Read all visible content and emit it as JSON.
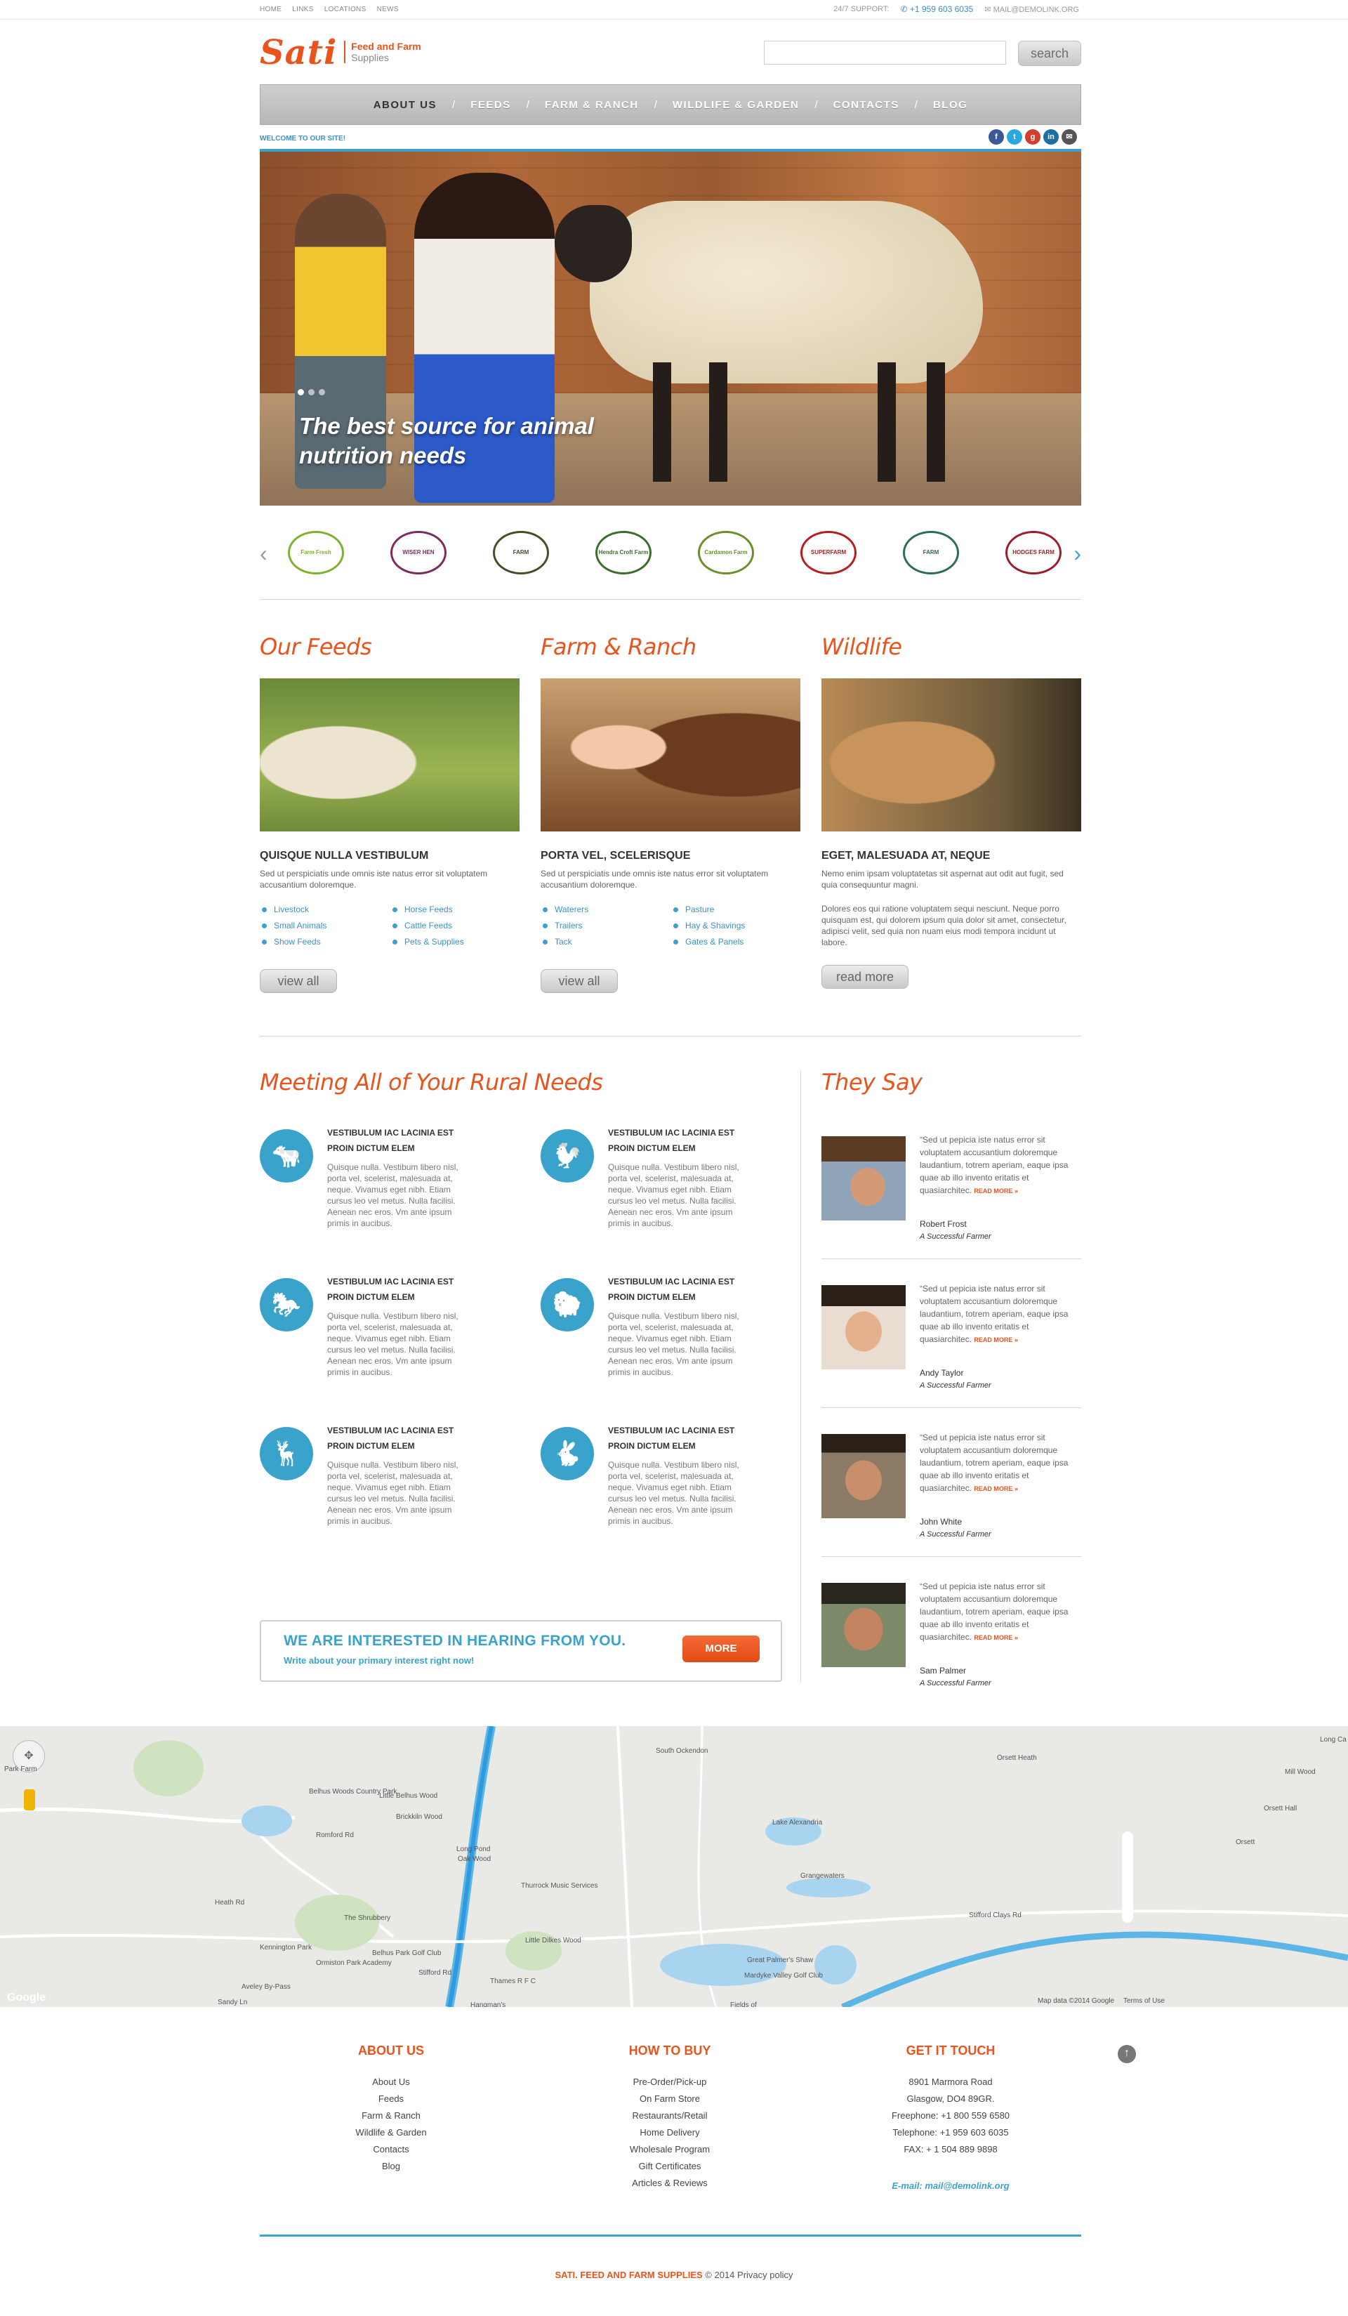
{
  "topbar": {
    "links": [
      "HOME",
      "LINKS",
      "LOCATIONS",
      "NEWS"
    ],
    "support_label": "24/7 SUPPORT:",
    "phone": "+1 959 603 6035",
    "email": "MAIL@DEMOLINK.ORG"
  },
  "logo": {
    "word": "Sati",
    "line1": "Feed and Farm",
    "line2": "Supplies"
  },
  "search": {
    "placeholder": "",
    "button": "search"
  },
  "nav": {
    "items": [
      "ABOUT US",
      "FEEDS",
      "FARM & RANCH",
      "WILDLIFE & GARDEN",
      "CONTACTS",
      "BLOG"
    ],
    "separator": "/"
  },
  "welcome": "WELCOME TO OUR SITE!",
  "social": [
    {
      "icon": "facebook-icon",
      "glyph": "f",
      "color": "#3b5998"
    },
    {
      "icon": "twitter-icon",
      "glyph": "t",
      "color": "#2aa9e0"
    },
    {
      "icon": "google-plus-icon",
      "glyph": "g",
      "color": "#d23f30"
    },
    {
      "icon": "linkedin-icon",
      "glyph": "in",
      "color": "#1b6fa3"
    },
    {
      "icon": "mail-icon",
      "glyph": "✉",
      "color": "#555555"
    }
  ],
  "hero": {
    "caption_line1": "The best source for animal",
    "caption_line2": "nutrition needs"
  },
  "brands": [
    {
      "name": "Farm Fresh",
      "color": "#7fb12c"
    },
    {
      "name": "WISER HEN",
      "color": "#7d2b5c"
    },
    {
      "name": "FARM",
      "color": "#4b4b2a"
    },
    {
      "name": "Hendra Croft Farm",
      "color": "#3e6d2a"
    },
    {
      "name": "Cardamon Farm",
      "color": "#6a8f2c"
    },
    {
      "name": "SUPERFARM",
      "color": "#b81d1d"
    },
    {
      "name": "FARM",
      "color": "#2b6d5b"
    },
    {
      "name": "HODGES FARM",
      "color": "#9a1f2a"
    }
  ],
  "columns": [
    {
      "heading": "Our Feeds",
      "title": "QUISQUE NULLA VESTIBULUM",
      "text": "Sed ut perspiciatis unde omnis iste natus error sit voluptatem accusantium doloremque.",
      "list_a": [
        "Livestock",
        "Small Animals",
        "Show Feeds"
      ],
      "list_b": [
        "Horse Feeds",
        "Cattle Feeds",
        "Pets & Supplies"
      ],
      "button": "view all"
    },
    {
      "heading": "Farm & Ranch",
      "title": "PORTA VEL, SCELERISQUE",
      "text": "Sed ut perspiciatis unde omnis iste natus error sit voluptatem accusantium doloremque.",
      "list_a": [
        "Waterers",
        "Trailers",
        "Tack"
      ],
      "list_b": [
        "Pasture",
        "Hay & Shavings",
        "Gates & Panels"
      ],
      "button": "view all"
    },
    {
      "heading": "Wildlife",
      "title": "EGET, MALESUADA AT, NEQUE",
      "text": "Nemo enim ipsam voluptatetas sit aspernat aut odit aut fugit, sed quia consequuntur magni.",
      "text2": "Dolores eos qui ratione voluptatem sequi nesciunt. Neque porro quisquam est, qui dolorem ipsum quia dolor sit amet, consectetur, adipisci velit, sed quia non nuam eius modi tempora incidunt ut labore.",
      "button": "read more"
    }
  ],
  "rural": {
    "heading": "Meeting All of Your Rural Needs",
    "items": [
      {
        "icon": "cow-icon",
        "title1": "VESTIBULUM IAC LACINIA EST",
        "title2": "PROIN DICTUM ELEM",
        "text": "Quisque nulla. Vestibum libero nisl, porta vel, scelerist, malesuada at, neque. Vivamus eget nibh. Etiam cursus leo vel metus. Nulla facilisi. Aenean nec eros. Vm ante ipsum primis in aucibus."
      },
      {
        "icon": "chicken-icon",
        "title1": "VESTIBULUM IAC LACINIA EST",
        "title2": "PROIN DICTUM ELEM",
        "text": "Quisque nulla. Vestibum libero nisl, porta vel, scelerist, malesuada at, neque. Vivamus eget nibh. Etiam cursus leo vel metus. Nulla facilisi. Aenean nec eros. Vm ante ipsum primis in aucibus."
      },
      {
        "icon": "horse-icon",
        "title1": "VESTIBULUM IAC LACINIA EST",
        "title2": "PROIN DICTUM ELEM",
        "text": "Quisque nulla. Vestibum libero nisl, porta vel, scelerist, malesuada at, neque. Vivamus eget nibh. Etiam cursus leo vel metus. Nulla facilisi. Aenean nec eros. Vm ante ipsum primis in aucibus."
      },
      {
        "icon": "sheep-icon",
        "title1": "VESTIBULUM IAC LACINIA EST",
        "title2": "PROIN DICTUM ELEM",
        "text": "Quisque nulla. Vestibum libero nisl, porta vel, scelerist, malesuada at, neque. Vivamus eget nibh. Etiam cursus leo vel metus. Nulla facilisi. Aenean nec eros. Vm ante ipsum primis in aucibus."
      },
      {
        "icon": "deer-icon",
        "title1": "VESTIBULUM IAC LACINIA EST",
        "title2": "PROIN DICTUM ELEM",
        "text": "Quisque nulla. Vestibum libero nisl, porta vel, scelerist, malesuada at, neque. Vivamus eget nibh. Etiam cursus leo vel metus. Nulla facilisi. Aenean nec eros. Vm ante ipsum primis in aucibus."
      },
      {
        "icon": "rabbit-icon",
        "title1": "VESTIBULUM IAC LACINIA EST",
        "title2": "PROIN DICTUM ELEM",
        "text": "Quisque nulla. Vestibum libero nisl, porta vel, scelerist, malesuada at, neque. Vivamus eget nibh. Etiam cursus leo vel metus. Nulla facilisi. Aenean nec eros. Vm ante ipsum primis in aucibus."
      }
    ]
  },
  "testimonials": {
    "heading": "They Say",
    "more": "READ MORE »",
    "items": [
      {
        "text": "“Sed ut pepicia iste natus error sit voluptatem accusantium doloremque laudantium, totrem aperiam, eaque ipsa quae ab illo invento eritatis et quasiarchitec.",
        "name": "Robert Frost",
        "role": "A Successful Farmer"
      },
      {
        "text": "“Sed ut pepicia iste natus error sit voluptatem accusantium doloremque laudantium, totrem aperiam, eaque ipsa quae ab illo invento eritatis et quasiarchitec.",
        "name": "Andy Taylor",
        "role": "A Successful Farmer"
      },
      {
        "text": "“Sed ut pepicia iste natus error sit voluptatem accusantium doloremque laudantium, totrem aperiam, eaque ipsa quae ab illo invento eritatis et quasiarchitec.",
        "name": "John White",
        "role": "A Successful Farmer"
      },
      {
        "text": "“Sed ut pepicia iste natus error sit voluptatem accusantium doloremque laudantium, totrem aperiam, eaque ipsa quae ab illo invento eritatis et quasiarchitec.",
        "name": "Sam Palmer",
        "role": "A Successful Farmer"
      }
    ]
  },
  "cta": {
    "heading": "WE ARE INTERESTED IN HEARING FROM YOU.",
    "sub": "Write about your primary interest right now!",
    "button": "MORE"
  },
  "map": {
    "labels": [
      "Belhus Woods Country Park",
      "Little Belhus Wood",
      "Brickkiln Wood",
      "Kennington Park",
      "The Shrubbery",
      "Belhus Park Golf Club",
      "Thurrock Music Services",
      "Little Dilkes Wood",
      "Lake Alexandria",
      "Grangewaters",
      "Great Palmer's Shaw",
      "Mardyke Valley Golf Club",
      "Orsett Heath",
      "South Ockendon",
      "Long Pond",
      "Oak Wood",
      "Orsett",
      "Stifford Clays Rd",
      "Aveley By-Pass",
      "Thames R F C",
      "Hangman's",
      "Fields of",
      "Ormiston Park Academy",
      "Park Farm",
      "Sandy Ln",
      "Romford Rd",
      "Stifford Rd",
      "Heath Rd",
      "Orsett Hall",
      "Mill Wood",
      "Long Ca"
    ],
    "attribution": "Map data ©2014 Google",
    "terms": "Terms of Use",
    "google": "Google"
  },
  "footer": {
    "about": {
      "title": "ABOUT US",
      "links": [
        "About Us",
        "Feeds",
        "Farm & Ranch",
        "Wildlife & Garden",
        "Contacts",
        "Blog"
      ]
    },
    "buy": {
      "title": "HOW TO BUY",
      "links": [
        "Pre-Order/Pick-up",
        "On Farm Store",
        "Restaurants/Retail",
        "Home Delivery",
        "Wholesale Program",
        "Gift Certificates",
        "Articles & Reviews"
      ]
    },
    "touch": {
      "title": "GET IT TOUCH",
      "lines": [
        "8901 Marmora Road",
        "Glasgow, DO4 89GR.",
        "Freephone: +1 800 559 6580",
        "Telephone: +1 959 603 6035",
        "FAX: + 1 504 889 9898"
      ],
      "email": "E-mail: mail@demolink.org"
    },
    "brand": "SATI. FEED AND FARM SUPPLIES",
    "copyright": "© 2014 Privacy policy"
  },
  "colors": {
    "accent": "#e8541c",
    "blue": "#3aa3cc"
  }
}
